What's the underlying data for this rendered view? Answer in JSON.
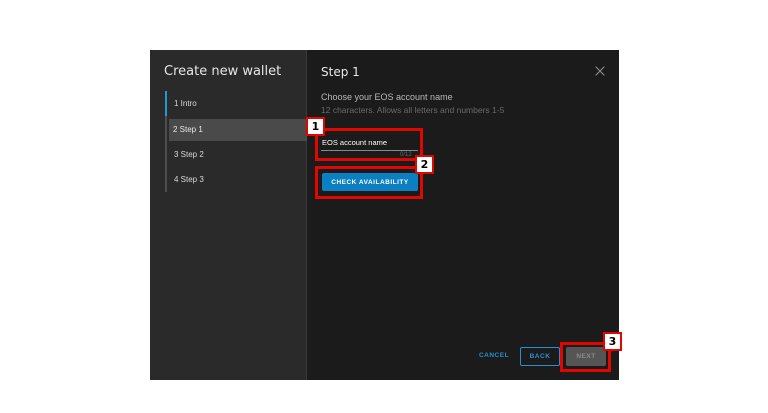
{
  "sidebar": {
    "title": "Create new wallet",
    "steps": [
      {
        "label": "1 Intro"
      },
      {
        "label": "2 Step 1"
      },
      {
        "label": "3 Step 2"
      },
      {
        "label": "4 Step 3"
      }
    ],
    "active_step_index": 1
  },
  "main": {
    "title": "Step 1",
    "subtitle": "Choose your EOS account name",
    "hint": "12 characters. Allows all letters and numbers 1-5",
    "account_field": {
      "placeholder": "EOS account name",
      "value": "",
      "counter": "0/12"
    },
    "check_button_label": "CHECK AVAILABILITY"
  },
  "footer": {
    "cancel_label": "CANCEL",
    "back_label": "BACK",
    "next_label": "NEXT",
    "next_disabled": true
  },
  "annotations": [
    {
      "label": "1"
    },
    {
      "label": "2"
    },
    {
      "label": "3"
    }
  ],
  "icons": {
    "close": "close-icon"
  },
  "colors": {
    "accent": "#0b7fc2",
    "active_rail": "#1d9bd6",
    "annotation": "#e10600",
    "dialog_bg": "#1b1b1b",
    "sidebar_bg": "#2a2a2a"
  }
}
